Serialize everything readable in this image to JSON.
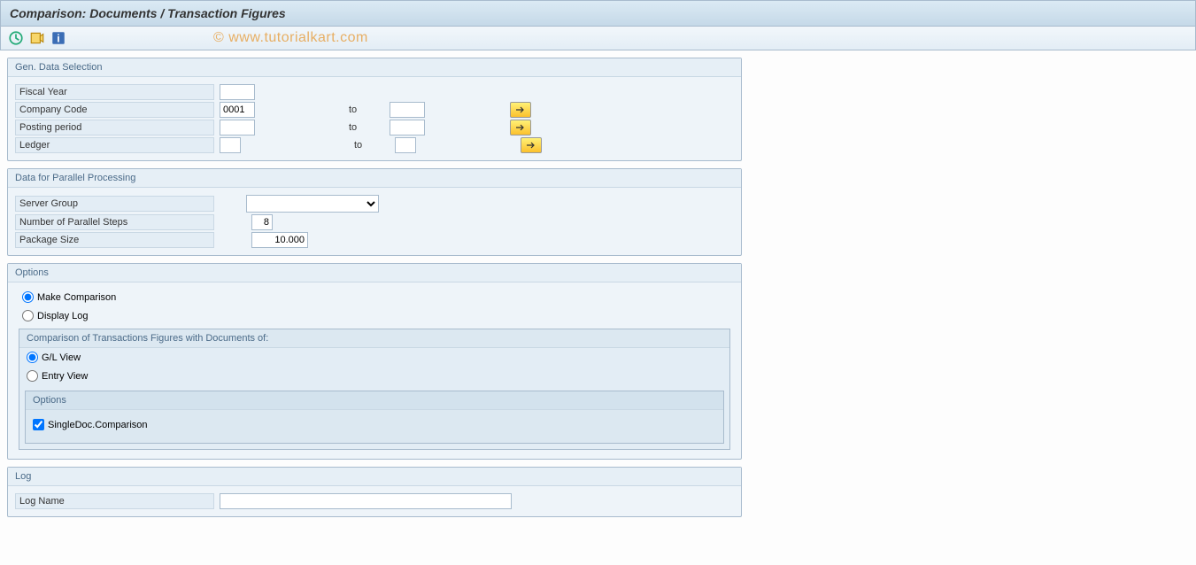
{
  "title": "Comparison: Documents / Transaction Figures",
  "watermark": "© www.tutorialkart.com",
  "toolbar_icons": [
    "execute",
    "variant",
    "info"
  ],
  "genData": {
    "title": "Gen. Data Selection",
    "fiscalYear": {
      "label": "Fiscal Year",
      "value": ""
    },
    "companyCode": {
      "label": "Company Code",
      "from": "0001",
      "toLabel": "to",
      "to": ""
    },
    "postingPeriod": {
      "label": "Posting period",
      "from": "",
      "toLabel": "to",
      "to": ""
    },
    "ledger": {
      "label": "Ledger",
      "from": "",
      "toLabel": "to",
      "to": ""
    }
  },
  "parallel": {
    "title": "Data for Parallel Processing",
    "serverGroup": {
      "label": "Server Group",
      "value": ""
    },
    "steps": {
      "label": "Number of Parallel Steps",
      "value": "8"
    },
    "packageSize": {
      "label": "Package Size",
      "value": "10.000"
    }
  },
  "options": {
    "title": "Options",
    "makeComparison": "Make Comparison",
    "displayLog": "Display Log",
    "subTitle": "Comparison of Transactions Figures with Documents of:",
    "glView": "G/L View",
    "entryView": "Entry View",
    "innerTitle": "Options",
    "singleDoc": "SingleDoc.Comparison"
  },
  "log": {
    "title": "Log",
    "logName": {
      "label": "Log Name",
      "value": ""
    }
  }
}
